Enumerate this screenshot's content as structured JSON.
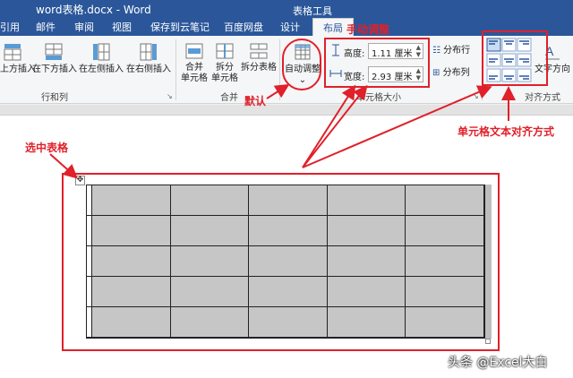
{
  "window": {
    "title": "word表格.docx - Word",
    "tool_context": "表格工具"
  },
  "tabs": [
    {
      "label": "引用"
    },
    {
      "label": "邮件"
    },
    {
      "label": "审阅"
    },
    {
      "label": "视图"
    },
    {
      "label": "保存到云笔记"
    },
    {
      "label": "百度网盘"
    },
    {
      "label": "设计"
    },
    {
      "label": "布局",
      "active": true
    }
  ],
  "ribbon": {
    "rows_cols": {
      "buttons": [
        "在上方插入",
        "在下方插入",
        "在左侧插入",
        "在右侧插入"
      ],
      "group_label": "行和列"
    },
    "merge": {
      "merge_cells": [
        "合并",
        "单元格"
      ],
      "split_cells": [
        "拆分",
        "单元格"
      ],
      "split_table": "拆分表格",
      "group_label": "合并"
    },
    "cell_size": {
      "autofit": "自动调整",
      "height_label": "高度:",
      "height_value": "1.11 厘米",
      "width_label": "宽度:",
      "width_value": "2.93 厘米",
      "distribute_rows": "分布行",
      "distribute_cols": "分布列",
      "group_label": "单元格大小"
    },
    "alignment": {
      "text_direction": "文字方向",
      "group_label": "对齐方式"
    }
  },
  "annotations": {
    "manual": "手动调整",
    "default": "默认",
    "select_table": "选中表格",
    "cell_text_align": "单元格文本对齐方式"
  },
  "colors": {
    "ribbon_blue": "#2b579a",
    "annotation_red": "#e0202a",
    "selection_gray": "#c6c6c6"
  },
  "table": {
    "rows": 5,
    "cols": 5
  },
  "watermark": "头条 @Excel大白"
}
